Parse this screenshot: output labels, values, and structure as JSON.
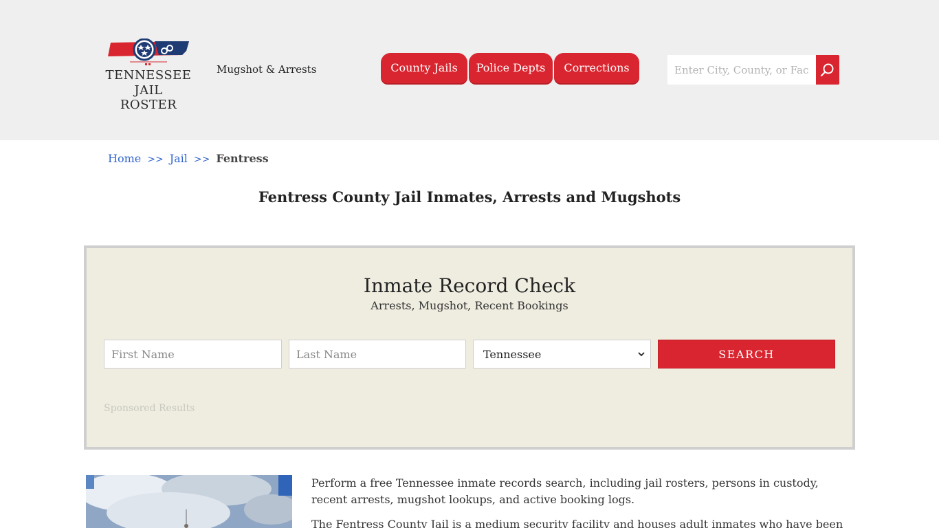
{
  "header": {
    "logo": {
      "line1": "TENNESSEE",
      "line2": "JAIL ROSTER"
    },
    "tagline": "Mugshot & Arrests",
    "nav": [
      {
        "label": "County Jails"
      },
      {
        "label": "Police Depts"
      },
      {
        "label": "Corrections"
      }
    ],
    "search": {
      "placeholder": "Enter City, County, or Facility"
    }
  },
  "breadcrumb": {
    "home": "Home",
    "sep": ">>",
    "jail": "Jail",
    "current": "Fentress"
  },
  "page_title": "Fentress County Jail Inmates, Arrests and Mugshots",
  "record_check": {
    "title": "Inmate Record Check",
    "subtitle": "Arrests, Mugshot, Recent Bookings",
    "first_name_placeholder": "First Name",
    "last_name_placeholder": "Last Name",
    "state_selected": "Tennessee",
    "search_label": "SEARCH",
    "sponsored": "Sponsored Results"
  },
  "content": {
    "paragraph1": "Perform a free Tennessee inmate records search, including jail rosters, persons in custody, recent arrests, mugshot lookups, and active booking logs.",
    "paragraph2": "The Fentress County Jail is a medium security facility and houses adult inmates who have been"
  },
  "colors": {
    "accent": "#d9252f",
    "header_bg": "#efefef",
    "box_bg": "#efede0",
    "link": "#3366cc"
  }
}
